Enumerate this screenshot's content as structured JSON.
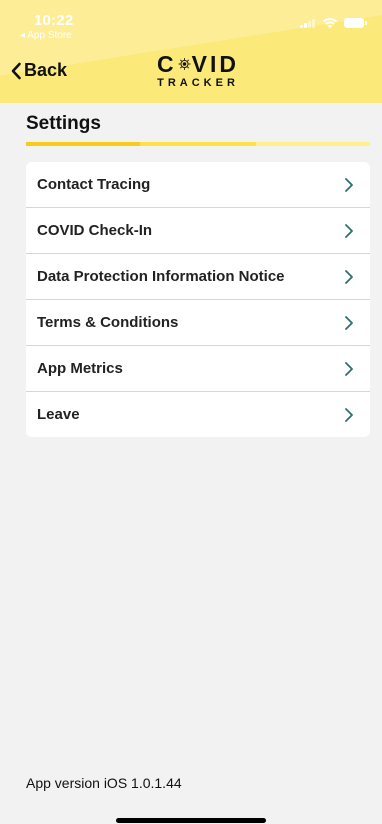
{
  "status_bar": {
    "time": "10:22",
    "back_app": "◂ App Store"
  },
  "nav": {
    "back_label": "Back",
    "logo_top_left": "C",
    "logo_top_right": "VID",
    "logo_bottom": "TRACKER"
  },
  "page": {
    "title": "Settings"
  },
  "menu": {
    "items": [
      {
        "label": "Contact Tracing"
      },
      {
        "label": "COVID Check-In"
      },
      {
        "label": "Data Protection Information Notice"
      },
      {
        "label": "Terms & Conditions"
      },
      {
        "label": "App Metrics"
      },
      {
        "label": "Leave"
      }
    ]
  },
  "footer": {
    "version": "App version iOS 1.0.1.44"
  },
  "colors": {
    "header_bg": "#fbe97a",
    "progress": [
      "#f5cc1f",
      "#ffe24a",
      "#fff08a"
    ],
    "chevron": "#2e6e6b"
  }
}
